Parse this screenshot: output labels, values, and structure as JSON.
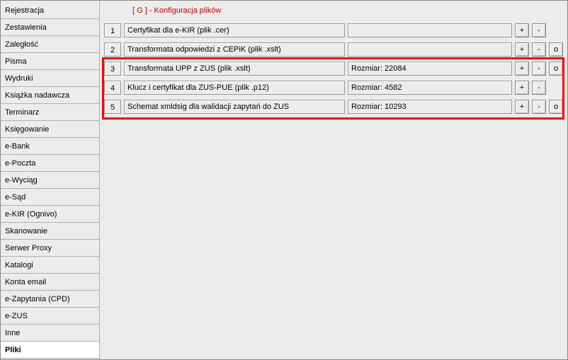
{
  "sidebar": {
    "items": [
      {
        "label": "Rejestracja"
      },
      {
        "label": "Zestawienia"
      },
      {
        "label": "Zaległość"
      },
      {
        "label": "Pisma"
      },
      {
        "label": "Wydruki"
      },
      {
        "label": "Książka nadawcza"
      },
      {
        "label": "Terminarz"
      },
      {
        "label": "Księgowanie"
      },
      {
        "label": "e-Bank"
      },
      {
        "label": "e-Poczta"
      },
      {
        "label": "e-Wyciąg"
      },
      {
        "label": "e-Sąd"
      },
      {
        "label": "e-KIR (Ognivo)"
      },
      {
        "label": "Skanowanie"
      },
      {
        "label": "Serwer Proxy"
      },
      {
        "label": "Katalogi"
      },
      {
        "label": "Konta email"
      },
      {
        "label": "e-Zapytania (CPD)"
      },
      {
        "label": "e-ZUS"
      },
      {
        "label": "Inne"
      },
      {
        "label": "Pliki"
      }
    ],
    "active_index": 20
  },
  "section_title": "[ G ] - Konfiguracja plików",
  "rows": [
    {
      "num": "1",
      "desc": "Certyfikat dla e-KIR (plik .cer)",
      "size": "",
      "has_o": false
    },
    {
      "num": "2",
      "desc": "Transformata odpowiedzi z CEPiK (plik .xslt)",
      "size": "",
      "has_o": true
    },
    {
      "num": "3",
      "desc": "Transformata UPP z ZUS (plik .xslt)",
      "size": "Rozmiar: 22084",
      "has_o": true
    },
    {
      "num": "4",
      "desc": "Klucz i certyfikat dla ZUS-PUE (plik .p12)",
      "size": "Rozmiar: 4582",
      "has_o": false
    },
    {
      "num": "5",
      "desc": "Schemat xmldsig dla walidacji zapytań do ZUS",
      "size": "Rozmiar: 10293",
      "has_o": true
    }
  ],
  "buttons": {
    "plus": "+",
    "minus": "-",
    "o": "o"
  }
}
